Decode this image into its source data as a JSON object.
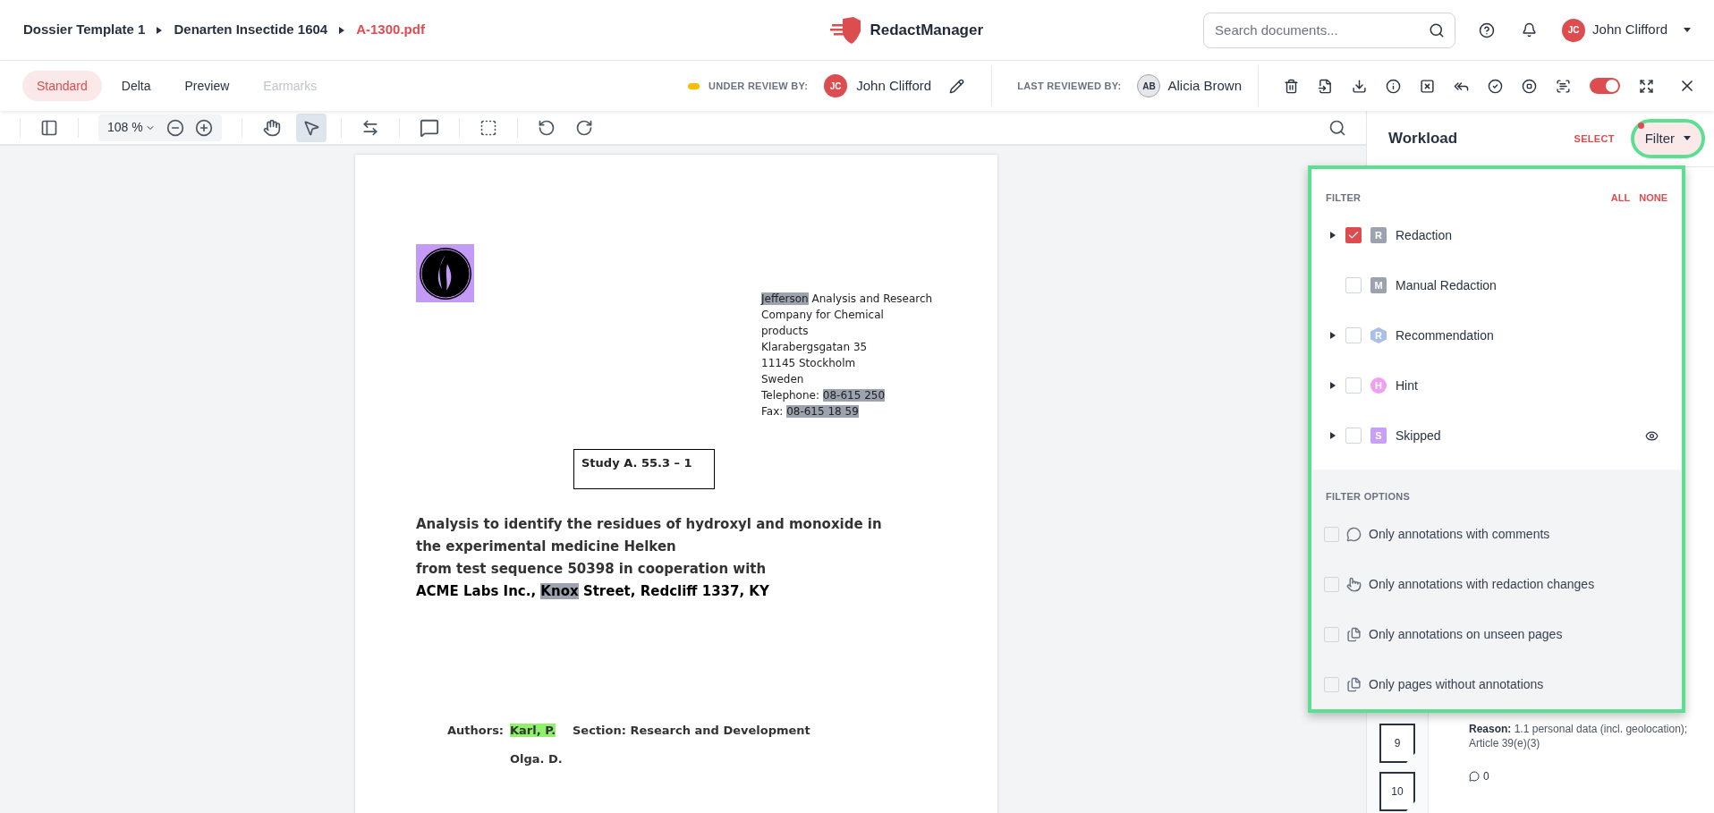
{
  "breadcrumbs": [
    {
      "label": "Dossier Template 1",
      "current": false
    },
    {
      "label": "Denarten Insectide 1604",
      "current": false
    },
    {
      "label": "A-1300.pdf",
      "current": true
    }
  ],
  "app_name": "RedactManager",
  "search": {
    "placeholder": "Search documents..."
  },
  "user": {
    "initials": "JC",
    "name": "John Clifford"
  },
  "view_tabs": [
    {
      "label": "Standard",
      "selected": true,
      "disabled": false
    },
    {
      "label": "Delta",
      "selected": false,
      "disabled": false
    },
    {
      "label": "Preview",
      "selected": false,
      "disabled": false
    },
    {
      "label": "Earmarks",
      "selected": false,
      "disabled": true
    }
  ],
  "under_review": {
    "label": "UNDER REVIEW BY:",
    "initials": "JC",
    "name": "John Clifford"
  },
  "last_reviewed": {
    "label": "LAST REVIEWED BY:",
    "initials": "AB",
    "name": "Alicia Brown"
  },
  "toggle_on": true,
  "viewer_toolbar": {
    "zoom": "108 %",
    "tools": [
      {
        "kind": "pan",
        "selected": false
      },
      {
        "kind": "select",
        "selected": true
      }
    ]
  },
  "document": {
    "address_lines": [
      [
        {
          "text": "Jefferson",
          "kind": "redaction"
        },
        {
          "text": " Analysis and Research",
          "kind": "text"
        }
      ],
      [
        {
          "text": "Company for Chemical",
          "kind": "text"
        }
      ],
      [
        {
          "text": "products",
          "kind": "text"
        }
      ],
      [
        {
          "text": "Klarabergsgatan 35",
          "kind": "text"
        }
      ],
      [
        {
          "text": "11145 Stockholm",
          "kind": "text"
        }
      ],
      [
        {
          "text": "Sweden",
          "kind": "text"
        }
      ],
      [
        {
          "text": "Telephone: ",
          "kind": "text"
        },
        {
          "text": "08-615 250",
          "kind": "redaction"
        }
      ],
      [
        {
          "text": "Fax: ",
          "kind": "text"
        },
        {
          "text": "08-615 18 59",
          "kind": "redaction"
        }
      ]
    ],
    "study": "Study A. 55.3 – 1",
    "title_lines": [
      [
        {
          "text": "Analysis to identify the residues of hydroxyl and monoxide in",
          "kind": "text"
        }
      ],
      [
        {
          "text": "the experimental medicine Helken",
          "kind": "text"
        }
      ],
      [
        {
          "text": "from test sequence 50398 in cooperation with",
          "kind": "text"
        }
      ],
      [
        {
          "text": "ACME Labs Inc., ",
          "kind": "text"
        },
        {
          "text": "Knox",
          "kind": "redaction"
        },
        {
          "text": " Street, Redcliff 1337, KY",
          "kind": "text"
        }
      ]
    ],
    "authors_label": "Authors:",
    "authors": [
      {
        "text": "Karl, P.",
        "kind": "hint"
      },
      {
        "text": "Olga. D.",
        "kind": "text"
      }
    ],
    "section": "Section: Research and Development"
  },
  "workload": {
    "title": "Workload",
    "select": "SELECT",
    "filter_button": "Filter",
    "filter_active": true,
    "pages": [
      "9",
      "10"
    ],
    "reason_label": "Reason:",
    "reason": "1.1 personal data (incl. geolocation); Article 39(e)(3)",
    "comments": "0"
  },
  "filter_menu": {
    "title": "FILTER",
    "actions": [
      "ALL",
      "NONE"
    ],
    "items": [
      {
        "label": "Redaction",
        "badge": "R",
        "kind": "square",
        "color": "#9ca3af",
        "checked": true,
        "expandable": true,
        "visible_toggle": false
      },
      {
        "label": "Manual Redaction",
        "badge": "M",
        "kind": "square",
        "color": "#9ca3af",
        "checked": false,
        "expandable": false,
        "visible_toggle": false
      },
      {
        "label": "Recommendation",
        "badge": "R",
        "kind": "hexagon",
        "color": "#a9bfe6",
        "checked": false,
        "expandable": true,
        "visible_toggle": false
      },
      {
        "label": "Hint",
        "badge": "H",
        "kind": "circle",
        "color": "#f0a0f0",
        "checked": false,
        "expandable": true,
        "visible_toggle": false
      },
      {
        "label": "Skipped",
        "badge": "S",
        "kind": "square",
        "color": "#c8a0f5",
        "checked": false,
        "expandable": true,
        "visible_toggle": true
      }
    ],
    "options_title": "FILTER OPTIONS",
    "options": [
      {
        "label": "Only annotations with comments",
        "kind": "comment",
        "checked": false
      },
      {
        "label": "Only annotations with redaction changes",
        "kind": "hand",
        "checked": false
      },
      {
        "label": "Only annotations on unseen pages",
        "kind": "pages",
        "checked": false
      },
      {
        "label": "Only pages without annotations",
        "kind": "pages",
        "checked": false
      }
    ]
  }
}
